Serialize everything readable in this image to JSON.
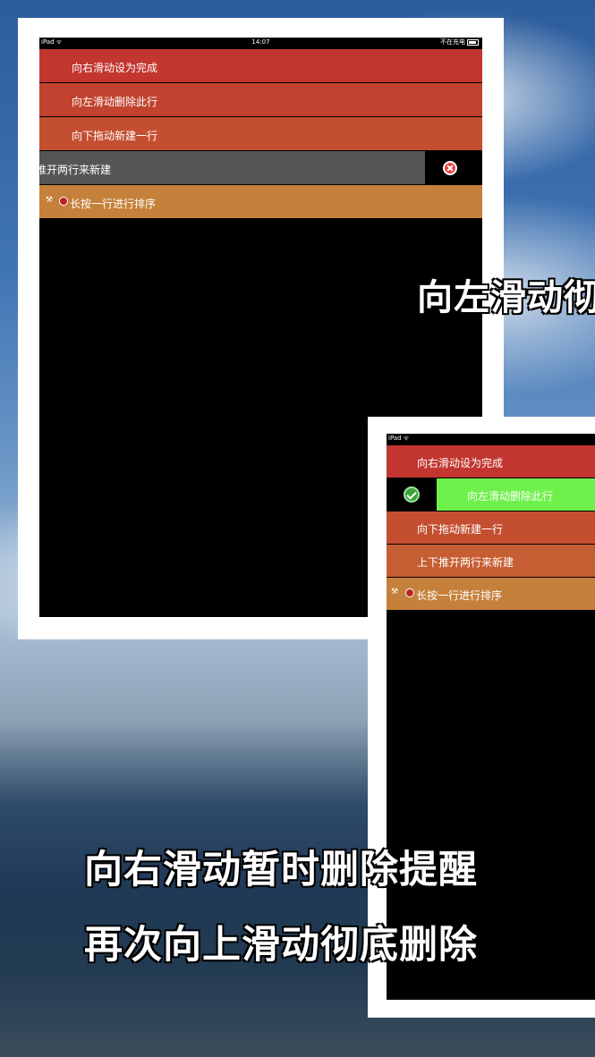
{
  "screen1": {
    "status": {
      "device": "iPad ᯤ",
      "time": "14:07",
      "battery": "不在充电"
    },
    "rows": [
      {
        "label": "向右滑动设为完成",
        "color": "#c2362f"
      },
      {
        "label": "向左滑动删除此行",
        "color": "#c1432f"
      },
      {
        "label": "向下拖动新建一行",
        "color": "#c44f30"
      },
      {
        "label": "推开两行来新建",
        "color": "#555555"
      },
      {
        "label": "长按一行进行排序",
        "color": "#c5813b"
      }
    ]
  },
  "screen2": {
    "status": {
      "device": "iPad ᯤ"
    },
    "rows": [
      {
        "label": "向右滑动设为完成",
        "color": "#c2362f"
      },
      {
        "label": "向左滑动删除此行",
        "color": "#6ef04a"
      },
      {
        "label": "向下拖动新建一行",
        "color": "#c44f30"
      },
      {
        "label": "上下推开两行来新建",
        "color": "#c65e33"
      },
      {
        "label": "长按一行进行排序",
        "color": "#c5813b"
      }
    ]
  },
  "captions": {
    "right_side": "向左滑动彻",
    "line1": "向右滑动暂时删除提醒",
    "line2": "再次向上滑动彻底删除"
  }
}
